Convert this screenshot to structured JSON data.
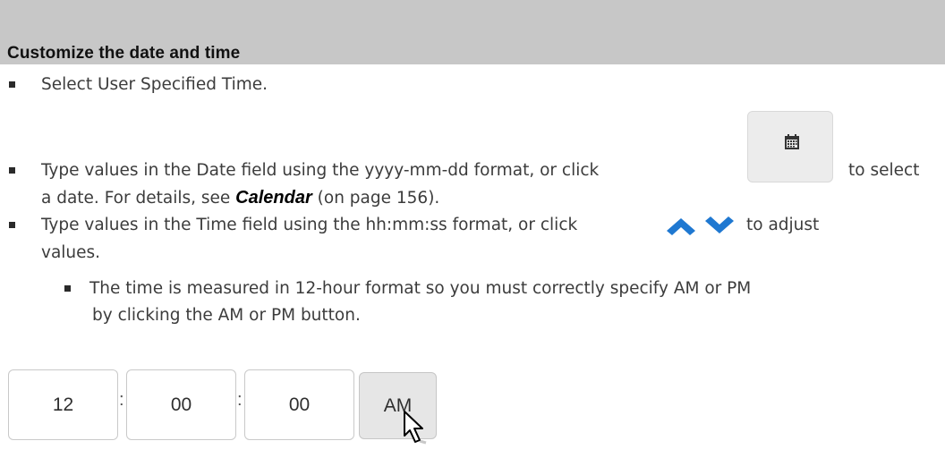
{
  "header": {
    "title": "Customize the date and time"
  },
  "steps": {
    "step1": "Select User Specified Time.",
    "step2_part1": "Type values in the Date field using the yyyy-mm-dd format, or click",
    "step2_part2": "to select",
    "step2_line2_before": "a date. For details, see",
    "step2_link": "Calendar",
    "step2_line2_after": "(on page 156).",
    "step3_part1": "Type values in the Time field using the hh:mm:ss format, or click",
    "step3_part2": "to adjust",
    "step3_line2": "values.",
    "sub1_line1": "The time is measured in 12-hour format so you must correctly specify AM or PM",
    "sub1_line2": "by clicking the AM or PM button."
  },
  "icons": {
    "calendar": "calendar-icon",
    "up": "chevron-up-icon",
    "down": "chevron-down-icon",
    "cursor": "mouse-pointer-icon"
  },
  "colors": {
    "header_bg": "#c7c7c7",
    "chevron": "#1f78d1"
  },
  "time_picker": {
    "hour": "12",
    "minute": "00",
    "second": "00",
    "separator": ":",
    "meridiem": "AM"
  }
}
